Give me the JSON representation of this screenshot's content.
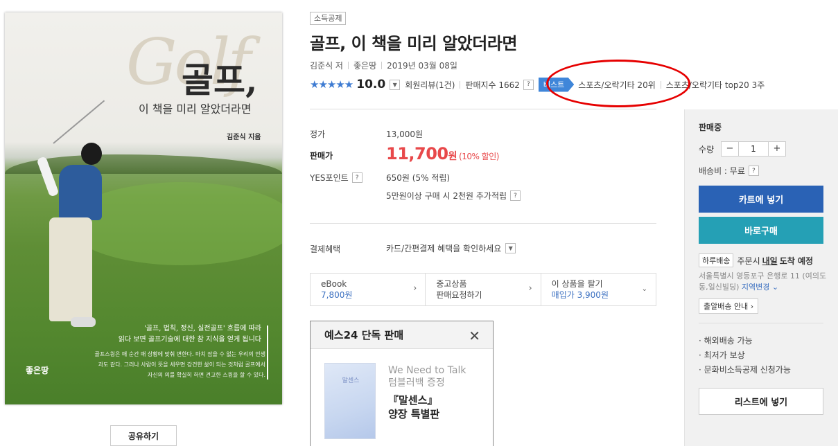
{
  "cover": {
    "script_word": "Golf",
    "title_main": "골프,",
    "title_sub": "이 책을 미리 알았더라면",
    "author_line": "김준식 지음",
    "quote_line1": "'골프, 법칙, 정신, 실전골프' 흐름에 따라",
    "quote_line2": "읽다 보면 골프기술에 대한 참 지식을 얻게 됩니다",
    "blurb": "골프스윙은 매 순간 매 상황에 맞춰 변한다. 마치 잡을 수 없는 우리의 인생과도 같다. 그러나 사람이 뜻을 세우면 강건한 삶이 되는 것처럼 골프에서 자신의 의를 확실히 하면 견고한 스윙을 할 수 있다.",
    "publisher_logo": "좋은땅"
  },
  "share_label": "공유하기",
  "badge_tax": "소득공제",
  "title": "골프, 이 책을 미리 알았더라면",
  "meta": {
    "author": "김준식 저",
    "publisher": "좋은땅",
    "date": "2019년 03월 08일"
  },
  "rating": {
    "stars": "★★★★★",
    "score": "10.0",
    "review": "회원리뷰(1건)",
    "sales_index": "판매지수 1662",
    "best_label": "베스트",
    "rank1": "스포츠/오락기타 20위",
    "rank2": "스포츠/오락기타 top20 3주"
  },
  "price": {
    "list_label": "정가",
    "list_value": "13,000원",
    "sale_label": "판매가",
    "sale_value": "11,700",
    "won": "원",
    "discount": "(10% 할인)",
    "points_label": "YES포인트",
    "points_value": "650원 (5% 적립)",
    "points_extra": "5만원이상 구매 시 2천원 추가적립"
  },
  "payment": {
    "label": "결제혜택",
    "value": "카드/간편결제 혜택을 확인하세요"
  },
  "options": [
    {
      "line1": "eBook",
      "line2": "7,800원"
    },
    {
      "line1": "중고상품",
      "line2": "판매요청하기"
    },
    {
      "line1": "이 상품을 팔기",
      "line2": "매입가 3,900원"
    }
  ],
  "exclusive": {
    "title": "예스24 단독 판매",
    "img_text": "말센스",
    "sub1": "We Need to Talk",
    "sub2": "텀블러백 증정",
    "main1": "『말센스』",
    "main2": "양장 특별판"
  },
  "panel": {
    "status": "판매중",
    "qty_label": "수량",
    "qty_value": "1",
    "minus": "−",
    "plus": "+",
    "ship": "배송비 : 무료",
    "cart": "카트에 넣기",
    "buy": "바로구매",
    "day_badge": "하루배송",
    "day_pre": "주문시",
    "day_when": "내일",
    "day_post": "도착 예정",
    "addr": "서울특별시 영등포구 은행로 11 (여의도동,일신빌딩)",
    "addr_change": "지역변경",
    "notify": "출알배송 안내",
    "bullets": [
      "· 해외배송 가능",
      "· 최저가 보상",
      "· 문화비소득공제 신청가능"
    ],
    "list_btn": "리스트에 넣기"
  },
  "colors": {
    "accent_blue": "#2a62b5",
    "teal": "#25a0b5",
    "price_red": "#e8484a",
    "highlight_red": "#e60000"
  }
}
